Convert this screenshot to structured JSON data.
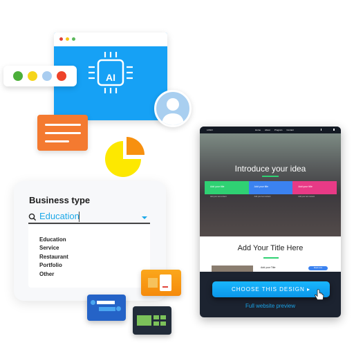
{
  "ai_window": {
    "label": "AI",
    "dots": [
      "#e0443a",
      "#f5c518",
      "#5cb85c"
    ]
  },
  "color_pill": {
    "colors": [
      "#4caf3a",
      "#f5d51a",
      "#a9cdf0",
      "#ee4329"
    ]
  },
  "business_type": {
    "title": "Business type",
    "input_value": "Education",
    "options": [
      "Education",
      "Service",
      "Restaurant",
      "Portfolio",
      "Other"
    ]
  },
  "preview": {
    "logo": "LOGO",
    "nav": [
      "Home",
      "About",
      "Program",
      "Contact"
    ],
    "hero_title": "Introduce your idea",
    "boxes": [
      {
        "title": "Add your title",
        "text": "Add your text content",
        "color": "#2fd173"
      },
      {
        "title": "Add your title",
        "text": "Add your text content",
        "color": "#3b82f0"
      },
      {
        "title": "Add your title",
        "text": "Add your text content",
        "color": "#e83a86"
      }
    ],
    "section_title": "Add Your Title Here",
    "row_title": "Add your Title",
    "row_button": "Read more",
    "cta": "CHOOSE THIS DESIGN ▸",
    "full_preview": "Full website preview"
  }
}
